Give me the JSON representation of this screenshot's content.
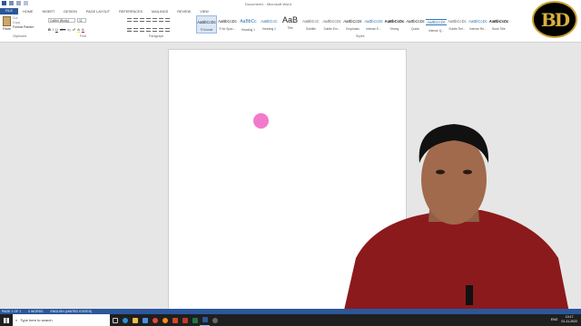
{
  "window": {
    "title": "Document1 - Microsoft Word"
  },
  "tabs": [
    "FILE",
    "HOME",
    "INSERT",
    "DESIGN",
    "PAGE LAYOUT",
    "REFERENCES",
    "MAILINGS",
    "REVIEW",
    "VIEW"
  ],
  "clipboard": {
    "paste": "Paste",
    "cut": "Cut",
    "copy": "Copy",
    "format_painter": "Format Painter",
    "label": "Clipboard"
  },
  "font": {
    "name": "Calibri (Body)",
    "size": "11",
    "label": "Font",
    "format_buttons": [
      "B",
      "I",
      "U",
      "abc",
      "x₂",
      "x²",
      "A",
      "A"
    ]
  },
  "paragraph": {
    "label": "Paragraph"
  },
  "styles": {
    "label": "Styles",
    "items": [
      {
        "sample": "AaBbCcDc",
        "name": "¶ Normal"
      },
      {
        "sample": "AaBbCcDc",
        "name": "¶ No Spac..."
      },
      {
        "sample": "AaBbCc",
        "name": "Heading 1"
      },
      {
        "sample": "AaBbCcC",
        "name": "Heading 2"
      },
      {
        "sample": "AaB",
        "name": "Title"
      },
      {
        "sample": "AaBbCcC",
        "name": "Subtitle"
      },
      {
        "sample": "AaBbCcDc",
        "name": "Subtle Em..."
      },
      {
        "sample": "AaBbCcDc",
        "name": "Emphasis"
      },
      {
        "sample": "AaBbCcDc",
        "name": "Intense E..."
      },
      {
        "sample": "AaBbCcDc",
        "name": "Strong"
      },
      {
        "sample": "AaBbCcDc",
        "name": "Quote"
      },
      {
        "sample": "AaBbCcDc",
        "name": "Intense Q..."
      },
      {
        "sample": "AaBbCcDc",
        "name": "Subtle Ref..."
      },
      {
        "sample": "AaBbCcDc",
        "name": "Intense Re..."
      },
      {
        "sample": "AaBbCcDc",
        "name": "Book Title"
      }
    ]
  },
  "status": {
    "page": "PAGE 1 OF 1",
    "words": "0 WORDS",
    "language": "ENGLISH (UNITED STATES)"
  },
  "taskbar": {
    "search_placeholder": "Type here to search",
    "lang": "ENG",
    "time": "10:17",
    "date": "01-11-2022"
  },
  "logo": {
    "letters": "BD"
  },
  "colors": {
    "accent": "#2b579a",
    "cursor_highlight": "#f16bc8",
    "logo_gold": "#c9a030"
  }
}
